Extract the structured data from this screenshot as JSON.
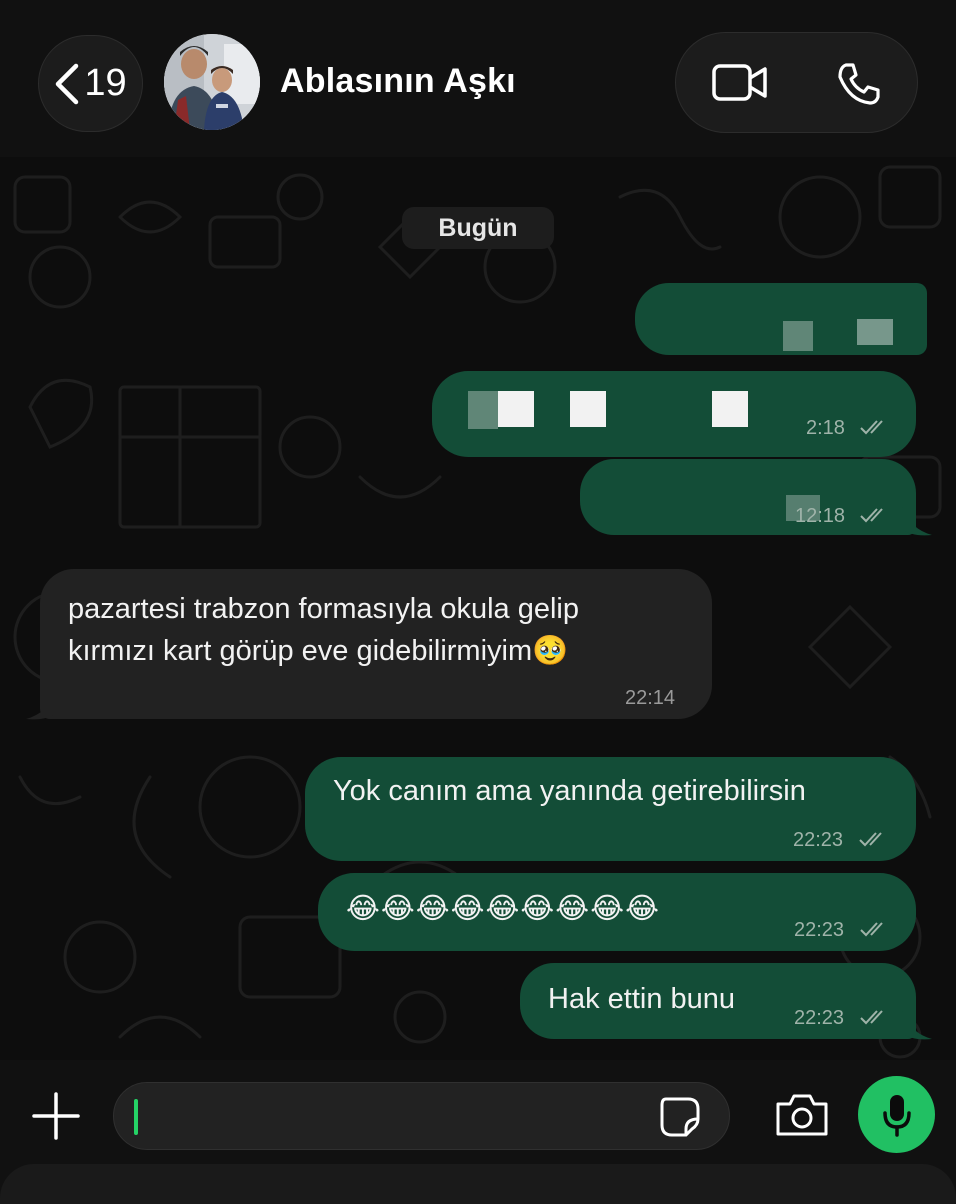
{
  "header": {
    "back_count": "19",
    "contact_name": "Ablasının Aşkı",
    "avatar": "profile-photo"
  },
  "chat": {
    "date_divider": "Bugün",
    "messages": [
      {
        "direction": "outgoing",
        "text": "",
        "time": "",
        "status": "read",
        "redacted": true
      },
      {
        "direction": "outgoing",
        "text": "",
        "time": "2:18",
        "status": "read",
        "redacted": true
      },
      {
        "direction": "outgoing",
        "text": "",
        "time": "12:18",
        "status": "read",
        "redacted": true
      },
      {
        "direction": "incoming",
        "lines": [
          "pazartesi trabzon formasıyla okula gelip",
          "kırmızı kart görüp eve gidebilirmiyim🥹"
        ],
        "time": "22:14"
      },
      {
        "direction": "outgoing",
        "text": "Yok canım ama yanında getirebilirsin",
        "time": "22:23",
        "status": "read"
      },
      {
        "direction": "outgoing",
        "text": "😂😂😂😂😂😂😂😂😂",
        "time": "22:23",
        "status": "read"
      },
      {
        "direction": "outgoing",
        "text": "Hak ettin bunu",
        "time": "22:23",
        "status": "read"
      }
    ]
  },
  "composer": {
    "input_value": "",
    "icons": [
      "plus-icon",
      "sticker-icon",
      "camera-icon",
      "microphone-icon"
    ]
  },
  "colors": {
    "outgoing_bubble": "#134d37",
    "incoming_bubble": "#222222",
    "accent": "#21c063"
  }
}
